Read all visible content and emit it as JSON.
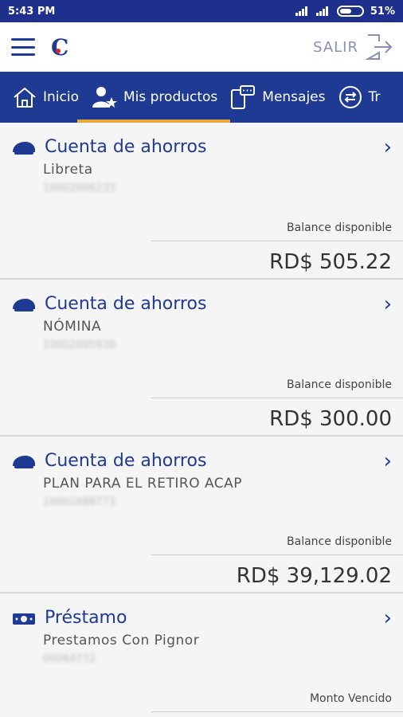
{
  "status_bar": {
    "time": "5:43 PM",
    "battery": "51%"
  },
  "app_bar": {
    "logout_label": "SALIR"
  },
  "tabs": [
    {
      "label": "Inicio",
      "icon": "home-icon"
    },
    {
      "label": "Mis productos",
      "icon": "user-star-icon",
      "active": true
    },
    {
      "label": "Mensajes",
      "icon": "phone-message-icon"
    },
    {
      "label": "Tr",
      "icon": "transfer-icon"
    }
  ],
  "products": [
    {
      "type": "Cuenta de ahorros",
      "icon": "piggy-bank-icon",
      "subtitle": "Libreta",
      "account": "10002006233",
      "balance_label": "Balance disponible",
      "amount": "RD$ 505.22"
    },
    {
      "type": "Cuenta de ahorros",
      "icon": "piggy-bank-icon",
      "subtitle": "NÓMINA",
      "account": "10002005938",
      "balance_label": "Balance disponible",
      "amount": "RD$ 300.00"
    },
    {
      "type": "Cuenta de ahorros",
      "icon": "piggy-bank-icon",
      "subtitle": "PLAN PARA EL RETIRO ACAP",
      "account": "10001688773",
      "balance_label": "Balance disponible",
      "amount": "RD$ 39,129.02"
    },
    {
      "type": "Préstamo",
      "icon": "loan-icon",
      "subtitle": "Prestamos Con Pignor",
      "account": "00064772",
      "balance_label": "Monto Vencido",
      "amount": ""
    }
  ],
  "colors": {
    "primary": "#1f3a93",
    "status_bar": "#1f2f8c",
    "tab_indicator": "#e7a93b"
  }
}
